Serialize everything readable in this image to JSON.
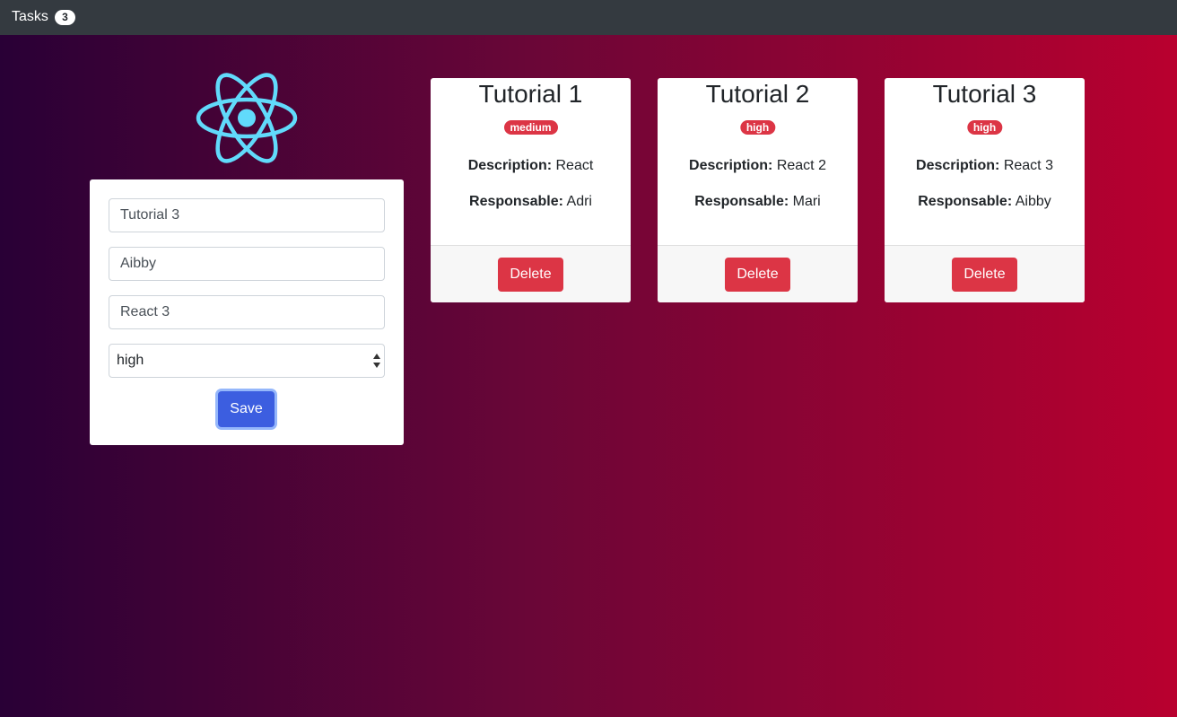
{
  "navbar": {
    "title": "Tasks",
    "count": "3"
  },
  "logo": {
    "icon": "react-logo-icon",
    "color": "#61dafb"
  },
  "form": {
    "title_value": "Tutorial 3",
    "responsible_value": "Aibby",
    "description_value": "React 3",
    "priority_selected": "high",
    "save_label": "Save"
  },
  "tasks": [
    {
      "title": "Tutorial 1",
      "priority": "medium",
      "description_label": "Description:",
      "description": "React",
      "responsible_label": "Responsable:",
      "responsible": "Adri",
      "delete_label": "Delete"
    },
    {
      "title": "Tutorial 2",
      "priority": "high",
      "description_label": "Description:",
      "description": "React 2",
      "responsible_label": "Responsable:",
      "responsible": "Mari",
      "delete_label": "Delete"
    },
    {
      "title": "Tutorial 3",
      "priority": "high",
      "description_label": "Description:",
      "description": "React 3",
      "responsible_label": "Responsable:",
      "responsible": "Aibby",
      "delete_label": "Delete"
    }
  ],
  "colors": {
    "navbar_bg": "#343a40",
    "danger": "#dc3545",
    "primary": "#3c5ee0",
    "gradient_start": "#290036",
    "gradient_end": "#b9002f"
  }
}
